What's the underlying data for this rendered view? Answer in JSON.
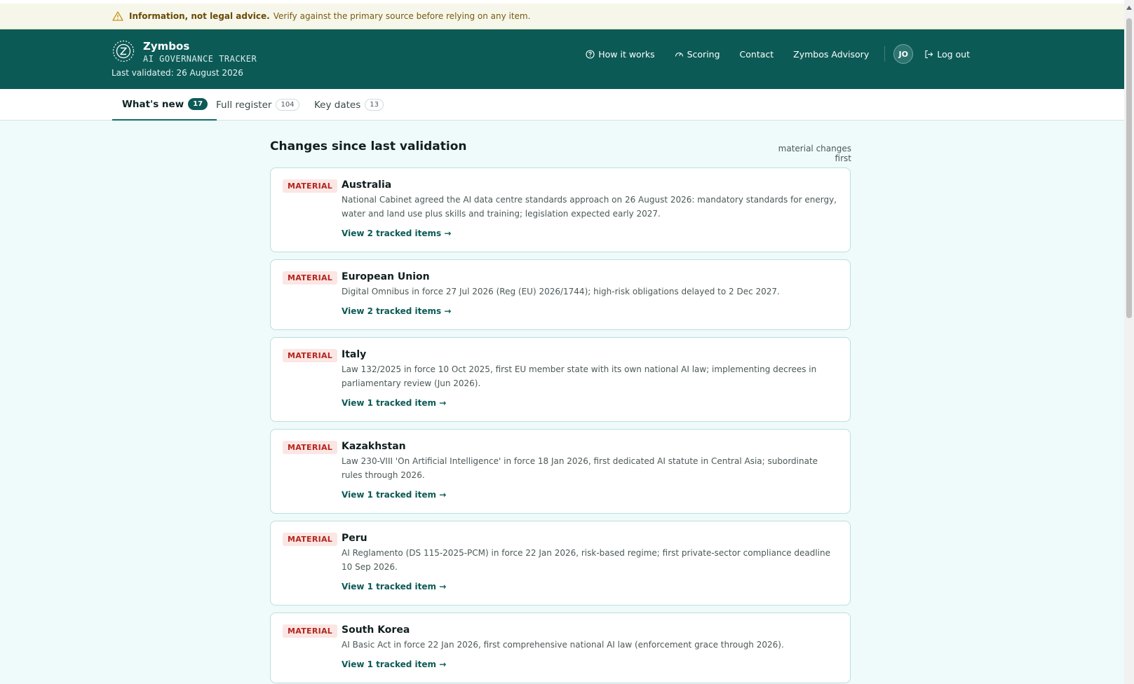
{
  "notice": {
    "bold": "Information, not legal advice.",
    "text": "Verify against the primary source before relying on any item."
  },
  "header": {
    "brand": "Zymbos",
    "subtitle": "AI GOVERNANCE TRACKER",
    "validated": "Last validated: 26 August 2026",
    "nav": {
      "how": "How it works",
      "scoring": "Scoring",
      "contact": "Contact",
      "advisory": "Zymbos Advisory",
      "avatar": "JO",
      "logout": "Log out"
    }
  },
  "tabs": [
    {
      "label": "What's new",
      "count": "17"
    },
    {
      "label": "Full register",
      "count": "104"
    },
    {
      "label": "Key dates",
      "count": "13"
    }
  ],
  "main": {
    "title": "Changes since last validation",
    "sort": "material changes first",
    "items": [
      {
        "badge": "MATERIAL",
        "country": "Australia",
        "desc": "National Cabinet agreed the AI data centre standards approach on 26 August 2026: mandatory standards for energy, water and land use plus skills and training; legislation expected early 2027.",
        "link": "View 2 tracked items →"
      },
      {
        "badge": "MATERIAL",
        "country": "European Union",
        "desc": "Digital Omnibus in force 27 Jul 2026 (Reg (EU) 2026/1744); high-risk obligations delayed to 2 Dec 2027.",
        "link": "View 2 tracked items →"
      },
      {
        "badge": "MATERIAL",
        "country": "Italy",
        "desc": "Law 132/2025 in force 10 Oct 2025, first EU member state with its own national AI law; implementing decrees in parliamentary review (Jun 2026).",
        "link": "View 1 tracked item →"
      },
      {
        "badge": "MATERIAL",
        "country": "Kazakhstan",
        "desc": "Law 230-VIII 'On Artificial Intelligence' in force 18 Jan 2026, first dedicated AI statute in Central Asia; subordinate rules through 2026.",
        "link": "View 1 tracked item →"
      },
      {
        "badge": "MATERIAL",
        "country": "Peru",
        "desc": "AI Reglamento (DS 115-2025-PCM) in force 22 Jan 2026, risk-based regime; first private-sector compliance deadline 10 Sep 2026.",
        "link": "View 1 tracked item →"
      },
      {
        "badge": "MATERIAL",
        "country": "South Korea",
        "desc": "AI Basic Act in force 22 Jan 2026, first comprehensive national AI law (enforcement grace through 2026).",
        "link": "View 1 tracked item →"
      }
    ]
  }
}
